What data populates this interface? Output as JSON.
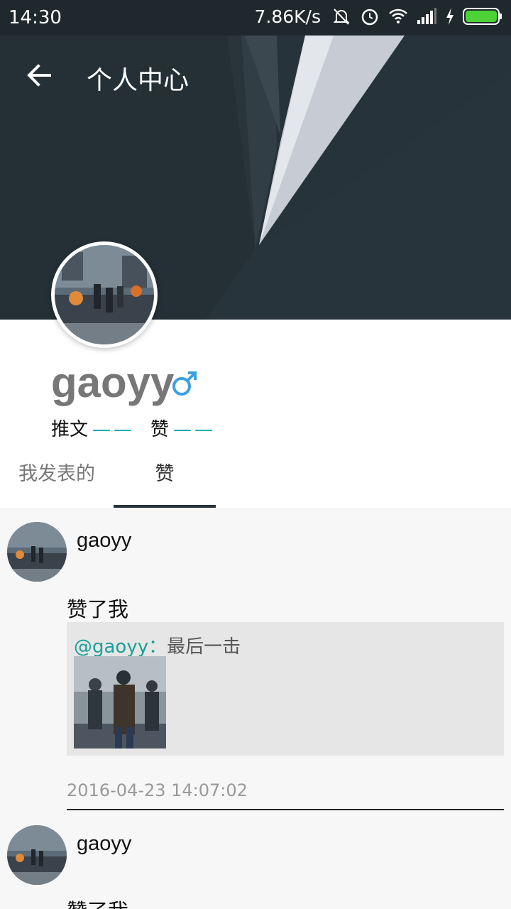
{
  "status_bar": {
    "time": "14:30",
    "net_speed": "7.86K/s",
    "icons": [
      "mute-bell-icon",
      "alarm-icon",
      "wifi-icon",
      "signal-icon",
      "charging-icon",
      "battery-icon"
    ]
  },
  "header": {
    "title": "个人中心",
    "back_icon": "back-arrow-icon"
  },
  "profile": {
    "username": "gaoyy",
    "gender_icon": "male-symbol-icon",
    "posts_label": "推文",
    "posts_count": "——",
    "likes_label": "赞",
    "likes_count": "——"
  },
  "tabs": [
    {
      "label": "我发表的",
      "active": false
    },
    {
      "label": "赞",
      "active": true
    }
  ],
  "feed": [
    {
      "name": "gaoyy",
      "text": "赞了我",
      "mention": "@gaoyy：",
      "quote_text": "最后一击",
      "time": "2016-04-23 14:07:02"
    },
    {
      "name": "gaoyy",
      "text": "赞了我"
    }
  ],
  "colors": {
    "header_bg": "#27333a",
    "accent_teal": "#1aa7a7",
    "gender_blue": "#3aa0e0",
    "battery_green": "#4cd137"
  }
}
